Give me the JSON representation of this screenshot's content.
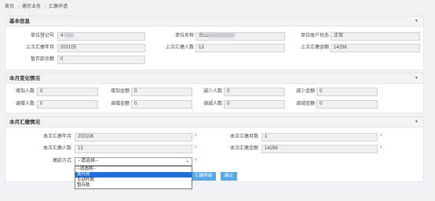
{
  "breadcrumb": [
    "首页",
    "缴存业务",
    "汇缴申请"
  ],
  "sections": {
    "basic": {
      "title": "基本信息",
      "fields": {
        "unit_reg_no": {
          "label": "单位登记号",
          "value": "4"
        },
        "unit_name": {
          "label": "单位名称",
          "value": "台山"
        },
        "unit_status": {
          "label": "单位账户状态",
          "value": "正常"
        },
        "last_pay_month": {
          "label": "上次汇缴年月",
          "value": "202105"
        },
        "last_pay_count": {
          "label": "上次汇缴人数",
          "value": "13"
        },
        "last_pay_amount": {
          "label": "上次汇缴金额",
          "value": "14256"
        },
        "temp_balance": {
          "label": "暂存款余额",
          "value": "0"
        }
      }
    },
    "change": {
      "title": "本月变化情况",
      "fields": {
        "add_count": {
          "label": "增加人数",
          "value": "0"
        },
        "add_amount": {
          "label": "增加金额",
          "value": "0"
        },
        "reduce_count": {
          "label": "减少人数",
          "value": "0"
        },
        "reduce_amount": {
          "label": "减少金额",
          "value": "0"
        },
        "up_count": {
          "label": "调增人数",
          "value": "0"
        },
        "up_amount": {
          "label": "调增金额",
          "value": "0"
        },
        "down_count": {
          "label": "调减人数",
          "value": "0"
        },
        "down_amount": {
          "label": "调减金额",
          "value": "0"
        }
      }
    },
    "pay": {
      "title": "本月汇缴情况",
      "fields": {
        "pay_month": {
          "label": "本次汇缴年月",
          "value": "202106"
        },
        "pay_months": {
          "label": "本次汇缴月数",
          "value": "1"
        },
        "pay_count": {
          "label": "本次汇缴人数",
          "value": "13"
        },
        "pay_amount": {
          "label": "本次汇缴金额",
          "value": "14256"
        },
        "pay_method": {
          "label": "缴款方式",
          "value": "--请选择--"
        }
      },
      "required_mark": "*",
      "options": [
        "--请选择--",
        "委托收",
        "主动托收",
        "暂存款"
      ],
      "selected_option_index": 1
    }
  },
  "buttons": {
    "submit": "汇缴明细",
    "confirm": "确认"
  },
  "icons": {
    "collapse": "chevron-down-icon",
    "select": "chevron-down-icon"
  },
  "colors": {
    "accent": "#5aa7e6",
    "selected": "#1e6fd9",
    "required": "#ee2233"
  }
}
